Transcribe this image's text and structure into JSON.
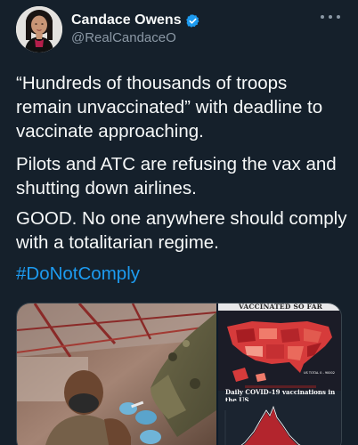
{
  "author": {
    "display_name": "Candace Owens",
    "handle": "@RealCandaceO",
    "verified": true,
    "avatar_icon": "profile-photo"
  },
  "menu": {
    "icon": "more-options-icon"
  },
  "tweet": {
    "paragraph_1": "“Hundreds of thousands of troops remain unvaccinated” with deadline to vaccinate approaching.",
    "paragraph_2": "Pilots and ATC are refusing the vax and shutting down airlines.",
    "paragraph_3": "GOOD. No one anywhere should comply with a totalitarian regime.",
    "hashtag": "#DoNotComply"
  },
  "media": {
    "graphic_title": "VACCINATED SO FAR",
    "us_total_label": "US TOTAL 0 - 90002",
    "chart_title": "Daily COVID-19 vaccinations in the US"
  },
  "colors": {
    "background": "#15202b",
    "text": "#f7f9f9",
    "secondary_text": "#8b98a5",
    "link": "#1d9bf0",
    "verified_badge": "#1d9bf0"
  }
}
